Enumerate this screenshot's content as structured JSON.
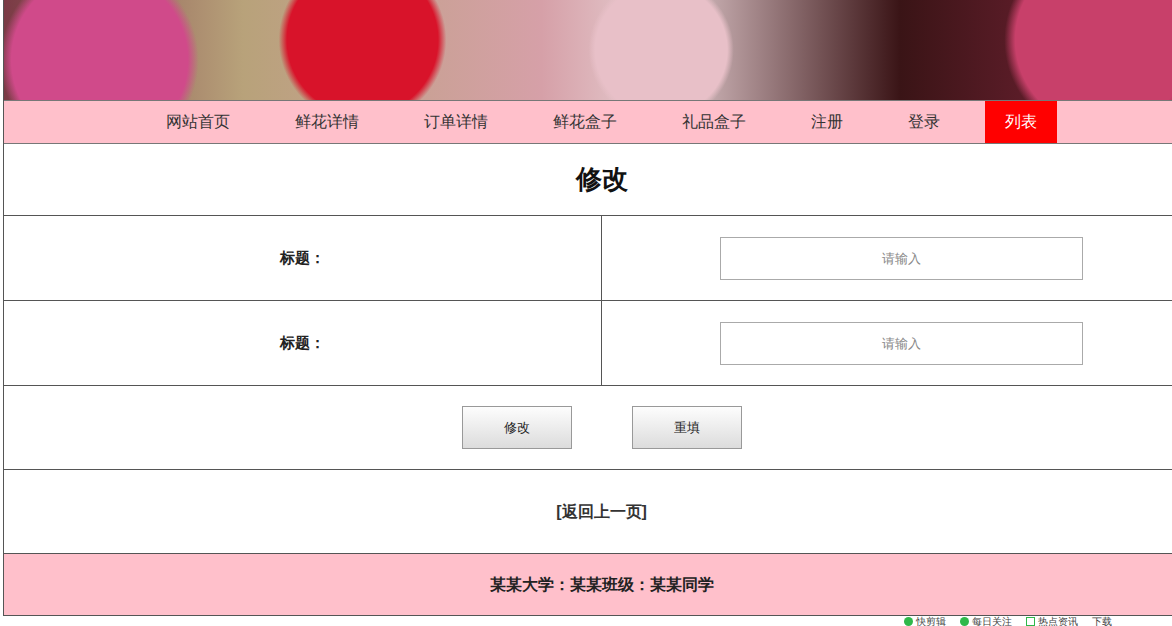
{
  "nav": [
    {
      "label": "网站首页",
      "selected": false
    },
    {
      "label": "鲜花详情",
      "selected": false
    },
    {
      "label": "订单详情",
      "selected": false
    },
    {
      "label": "鲜花盒子",
      "selected": false
    },
    {
      "label": "礼品盒子",
      "selected": false
    },
    {
      "label": "注册",
      "selected": false
    },
    {
      "label": "登录",
      "selected": false
    },
    {
      "label": "列表",
      "selected": true
    }
  ],
  "form": {
    "title": "修改",
    "fields": [
      {
        "label": "标题：",
        "placeholder": "请输入"
      },
      {
        "label": "标题：",
        "placeholder": "请输入"
      }
    ],
    "buttons": [
      "修改",
      "重填"
    ]
  },
  "back_link": "[返回上一页]",
  "footer": "某某大学：某某班级：某某同学",
  "status_bar": {
    "items": [
      {
        "label": "快剪辑",
        "kind": "dot"
      },
      {
        "label": "每日关注",
        "kind": "dot"
      },
      {
        "label": "热点资讯",
        "kind": "box"
      },
      {
        "label": "下载",
        "kind": "plain"
      }
    ]
  }
}
